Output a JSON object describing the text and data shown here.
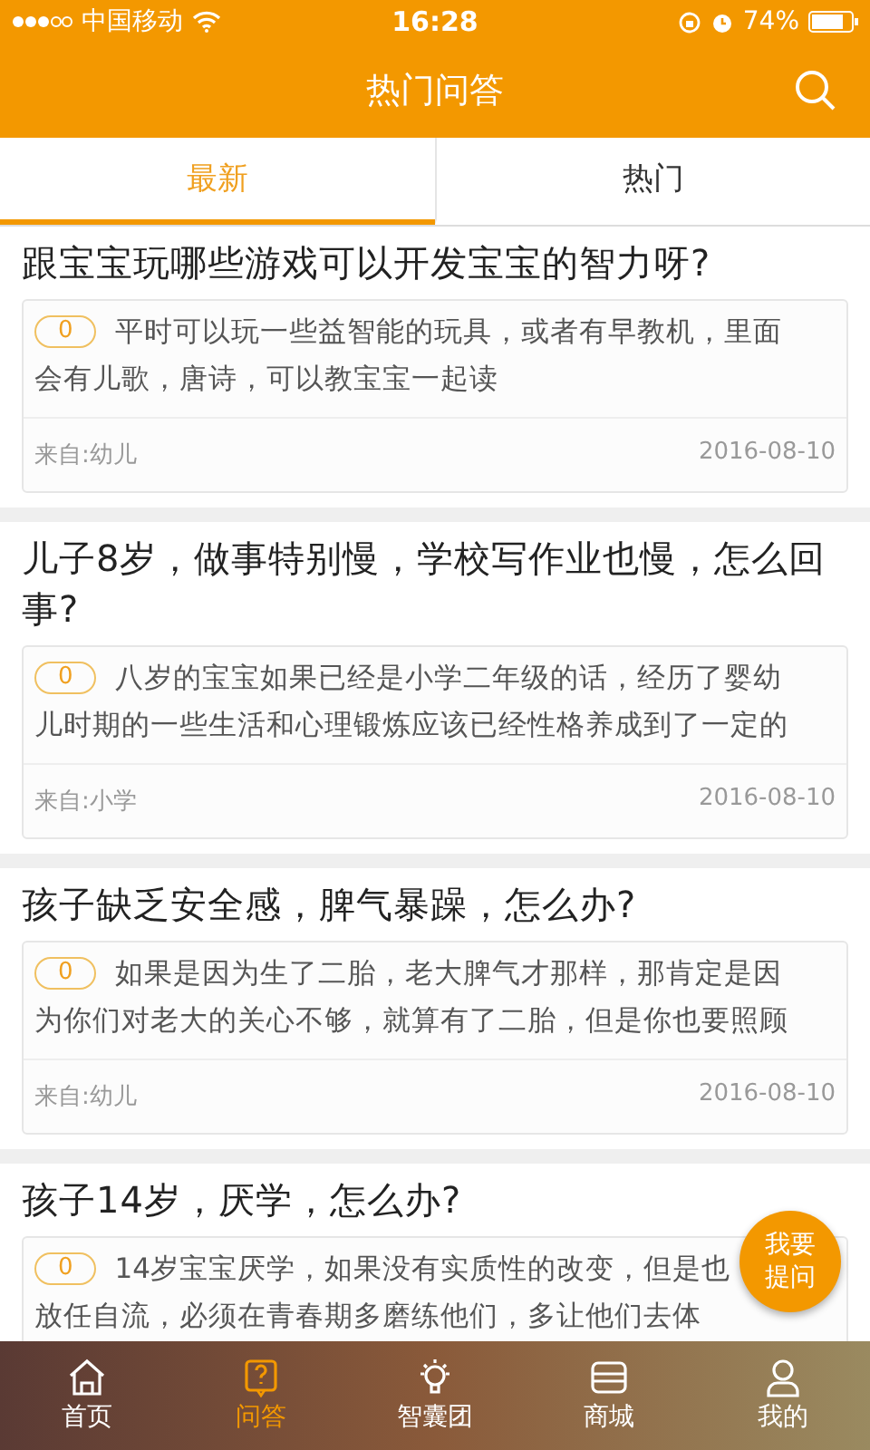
{
  "status_bar": {
    "carrier": "中国移动",
    "time": "16:28",
    "battery": "74%"
  },
  "header": {
    "title": "热门问答"
  },
  "tabs": [
    {
      "label": "最新",
      "selected": true
    },
    {
      "label": "热门",
      "selected": false
    }
  ],
  "questions": [
    {
      "title": "跟宝宝玩哪些游戏可以开发宝宝的智力呀?",
      "count": "0",
      "answer_lines": [
        "平时可以玩一些益智能的玩具，或者有早教机，里面",
        "会有儿歌，唐诗，可以教宝宝一起读"
      ],
      "source": "来自:幼儿",
      "date": "2016-08-10"
    },
    {
      "title": "儿子8岁，做事特别慢，学校写作业也慢，怎么回事?",
      "count": "0",
      "answer_lines": [
        "八岁的宝宝如果已经是小学二年级的话，经历了婴幼",
        "儿时期的一些生活和心理锻炼应该已经性格养成到了一定的"
      ],
      "source": "来自:小学",
      "date": "2016-08-10"
    },
    {
      "title": "孩子缺乏安全感，脾气暴躁，怎么办?",
      "count": "0",
      "answer_lines": [
        "如果是因为生了二胎，老大脾气才那样，那肯定是因",
        "为你们对老大的关心不够，就算有了二胎，但是你也要照顾"
      ],
      "source": "来自:幼儿",
      "date": "2016-08-10"
    },
    {
      "title": "孩子14岁，厌学，怎么办?",
      "count": "0",
      "answer_lines": [
        "14岁宝宝厌学，如果没有实质性的改变，但是也",
        "放任自流，必须在青春期多磨练他们，多让他们去体"
      ]
    }
  ],
  "ask_button": {
    "label": "我要提问"
  },
  "nav": [
    {
      "label": "首页",
      "selected": false
    },
    {
      "label": "问答",
      "selected": true
    },
    {
      "label": "智囊团",
      "selected": false
    },
    {
      "label": "商城",
      "selected": false
    },
    {
      "label": "我的",
      "selected": false
    }
  ]
}
